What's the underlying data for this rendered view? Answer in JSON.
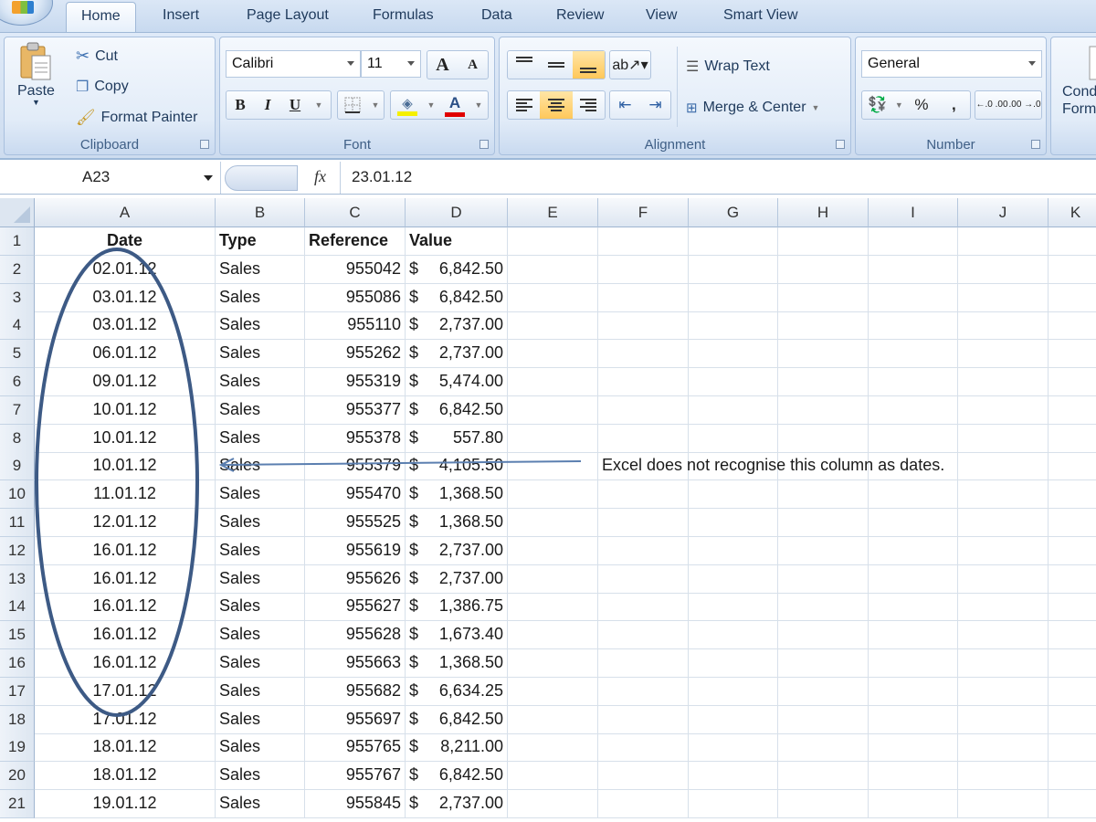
{
  "tabs": [
    "Home",
    "Insert",
    "Page Layout",
    "Formulas",
    "Data",
    "Review",
    "View",
    "Smart View"
  ],
  "active_tab": "Home",
  "ribbon": {
    "clipboard": {
      "label": "Clipboard",
      "paste": "Paste",
      "cut": "Cut",
      "copy": "Copy",
      "format_painter": "Format Painter"
    },
    "font": {
      "label": "Font",
      "font_name": "Calibri",
      "font_size": "11",
      "bold": "B",
      "italic": "I",
      "underline": "U",
      "grow": "A",
      "shrink": "A",
      "font_color": "A"
    },
    "alignment": {
      "label": "Alignment",
      "wrap_text": "Wrap Text",
      "merge_center": "Merge & Center"
    },
    "number": {
      "label": "Number",
      "format": "General",
      "percent": "%",
      "comma": ",",
      "inc_decimal": "←.0 .00",
      "dec_decimal": ".00 →.0"
    },
    "styles": {
      "conditional_formatting_line1": "Cond",
      "conditional_formatting_line2": "Form"
    }
  },
  "formula_bar": {
    "name_box": "A23",
    "fx": "fx",
    "value": "23.01.12"
  },
  "columns": [
    "A",
    "B",
    "C",
    "D",
    "E",
    "F",
    "G",
    "H",
    "I",
    "J",
    "K"
  ],
  "header_row": {
    "row": "1",
    "date": "Date",
    "type": "Type",
    "reference": "Reference",
    "value": "Value"
  },
  "rows": [
    {
      "n": "2",
      "date": "02.01.12",
      "type": "Sales",
      "ref": "955042",
      "cur": "$",
      "amt": "6,842.50"
    },
    {
      "n": "3",
      "date": "03.01.12",
      "type": "Sales",
      "ref": "955086",
      "cur": "$",
      "amt": "6,842.50"
    },
    {
      "n": "4",
      "date": "03.01.12",
      "type": "Sales",
      "ref": "955110",
      "cur": "$",
      "amt": "2,737.00"
    },
    {
      "n": "5",
      "date": "06.01.12",
      "type": "Sales",
      "ref": "955262",
      "cur": "$",
      "amt": "2,737.00"
    },
    {
      "n": "6",
      "date": "09.01.12",
      "type": "Sales",
      "ref": "955319",
      "cur": "$",
      "amt": "5,474.00"
    },
    {
      "n": "7",
      "date": "10.01.12",
      "type": "Sales",
      "ref": "955377",
      "cur": "$",
      "amt": "6,842.50"
    },
    {
      "n": "8",
      "date": "10.01.12",
      "type": "Sales",
      "ref": "955378",
      "cur": "$",
      "amt": "557.80"
    },
    {
      "n": "9",
      "date": "10.01.12",
      "type": "Sales",
      "ref": "955379",
      "cur": "$",
      "amt": "4,105.50"
    },
    {
      "n": "10",
      "date": "11.01.12",
      "type": "Sales",
      "ref": "955470",
      "cur": "$",
      "amt": "1,368.50"
    },
    {
      "n": "11",
      "date": "12.01.12",
      "type": "Sales",
      "ref": "955525",
      "cur": "$",
      "amt": "1,368.50"
    },
    {
      "n": "12",
      "date": "16.01.12",
      "type": "Sales",
      "ref": "955619",
      "cur": "$",
      "amt": "2,737.00"
    },
    {
      "n": "13",
      "date": "16.01.12",
      "type": "Sales",
      "ref": "955626",
      "cur": "$",
      "amt": "2,737.00"
    },
    {
      "n": "14",
      "date": "16.01.12",
      "type": "Sales",
      "ref": "955627",
      "cur": "$",
      "amt": "1,386.75"
    },
    {
      "n": "15",
      "date": "16.01.12",
      "type": "Sales",
      "ref": "955628",
      "cur": "$",
      "amt": "1,673.40"
    },
    {
      "n": "16",
      "date": "16.01.12",
      "type": "Sales",
      "ref": "955663",
      "cur": "$",
      "amt": "1,368.50"
    },
    {
      "n": "17",
      "date": "17.01.12",
      "type": "Sales",
      "ref": "955682",
      "cur": "$",
      "amt": "6,634.25"
    },
    {
      "n": "18",
      "date": "17.01.12",
      "type": "Sales",
      "ref": "955697",
      "cur": "$",
      "amt": "6,842.50"
    },
    {
      "n": "19",
      "date": "18.01.12",
      "type": "Sales",
      "ref": "955765",
      "cur": "$",
      "amt": "8,211.00"
    },
    {
      "n": "20",
      "date": "18.01.12",
      "type": "Sales",
      "ref": "955767",
      "cur": "$",
      "amt": "6,842.50"
    },
    {
      "n": "21",
      "date": "19.01.12",
      "type": "Sales",
      "ref": "955845",
      "cur": "$",
      "amt": "2,737.00"
    }
  ],
  "annotation": {
    "text": "Excel does not recognise this column as dates.",
    "row": "9",
    "column": "F"
  },
  "colors": {
    "annotation_stroke": "#3d5a85",
    "arrow_stroke": "#5b7fb0",
    "selected_button": "#ffc85a"
  }
}
